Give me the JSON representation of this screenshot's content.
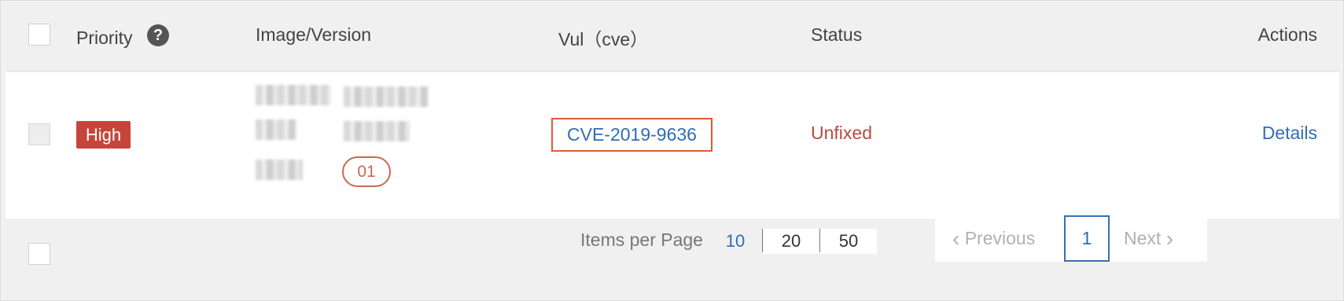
{
  "table": {
    "columns": {
      "priority": "Priority",
      "image_version": "Image/Version",
      "vul": "Vul（cve）",
      "status": "Status",
      "actions": "Actions"
    },
    "help_icon": "?",
    "rows": [
      {
        "priority": "High",
        "tag_count": "01",
        "cve": "CVE-2019-9636",
        "status": "Unfixed",
        "action": "Details"
      }
    ]
  },
  "pagination": {
    "items_per_page_label": "Items per Page",
    "sizes": [
      "10",
      "20",
      "50"
    ],
    "selected_size": "10",
    "previous_label": "Previous",
    "current_page": "1",
    "next_label": "Next"
  },
  "colors": {
    "priority_high": "#c6453a",
    "status_unfixed": "#b94a3c",
    "link": "#2f6db5",
    "highlight_border": "#e2573a"
  }
}
